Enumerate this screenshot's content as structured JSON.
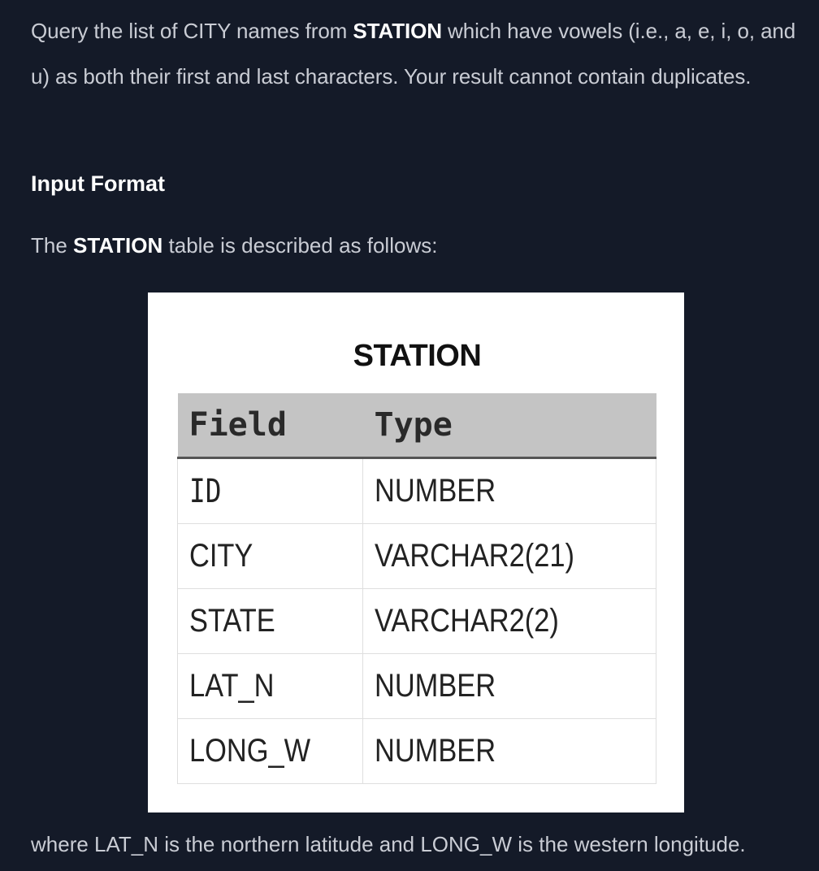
{
  "intro": {
    "part1": "Query the list of CITY names from ",
    "table_name": "STATION",
    "part2": " which have vowels (i.e., a, e, i, o, and u) as both their first and last characters. Your result cannot contain duplicates."
  },
  "input_format": {
    "heading": "Input Format",
    "desc_part1": "The ",
    "desc_table": "STATION",
    "desc_part2": " table is described as follows:"
  },
  "figure": {
    "title": "STATION",
    "headers": [
      "Field",
      "Type"
    ],
    "rows": [
      [
        "ID",
        "NUMBER"
      ],
      [
        "CITY",
        "VARCHAR2(21)"
      ],
      [
        "STATE",
        "VARCHAR2(2)"
      ],
      [
        "LAT_N",
        "NUMBER"
      ],
      [
        "LONG_W",
        "NUMBER"
      ]
    ]
  },
  "footer": "where LAT_N is the northern latitude and LONG_W is the western longitude."
}
